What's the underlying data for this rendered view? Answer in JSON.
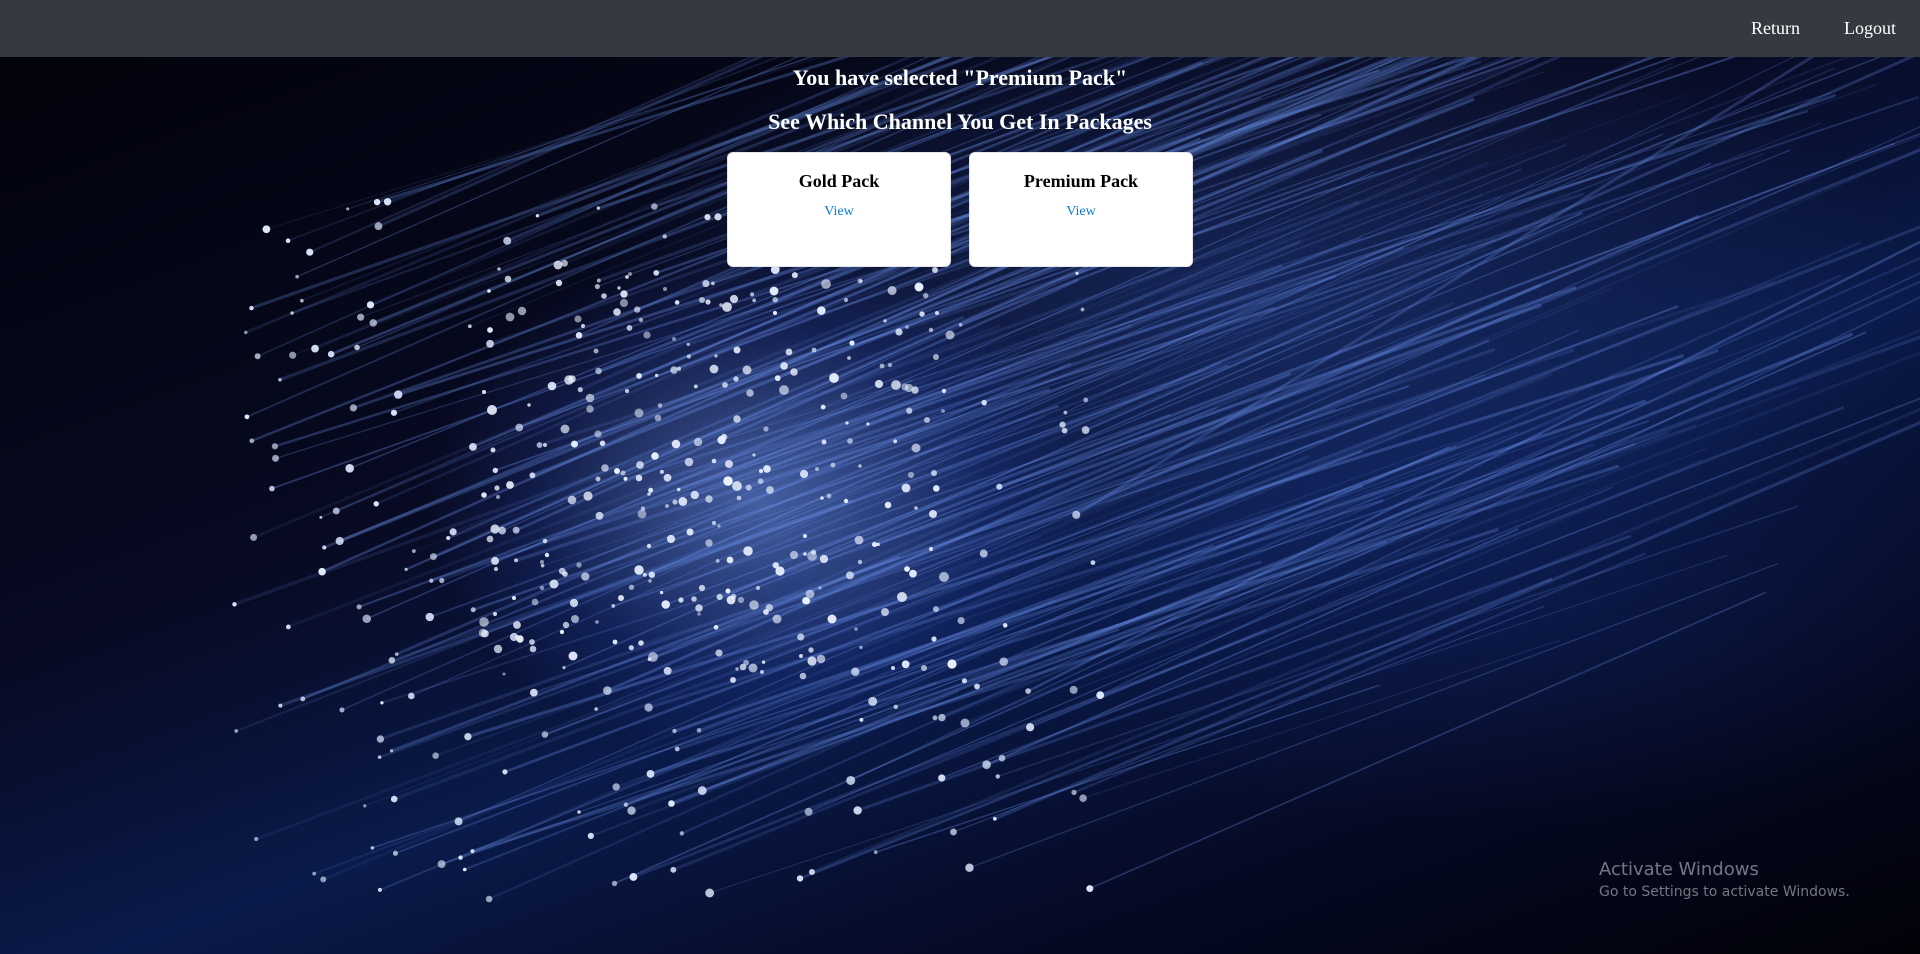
{
  "nav": {
    "return_label": "Return",
    "logout_label": "Logout"
  },
  "main": {
    "selected_heading": "You have selected \"Premium Pack\"",
    "subheading": "See Which Channel You Get In Packages",
    "packages": [
      {
        "title": "Gold Pack",
        "link": "View"
      },
      {
        "title": "Premium Pack",
        "link": "View"
      }
    ]
  },
  "watermark": {
    "title": "Activate Windows",
    "subtitle": "Go to Settings to activate Windows."
  },
  "colors": {
    "navbar": "#343a40",
    "link": "#0a7bd6",
    "background": "#03030f"
  }
}
